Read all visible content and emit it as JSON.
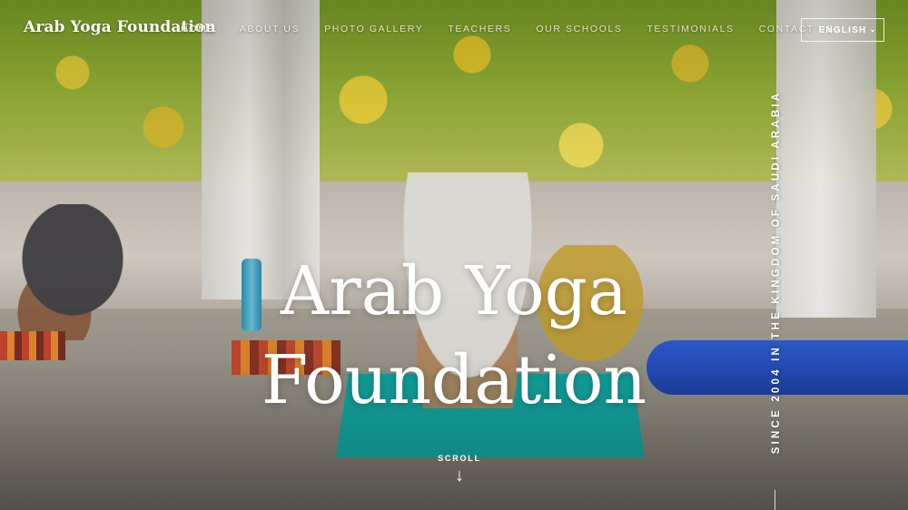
{
  "brand": {
    "name": "Arab Yoga Foundation"
  },
  "nav": {
    "items": [
      {
        "label": "HOME"
      },
      {
        "label": "ABOUT US"
      },
      {
        "label": "PHOTO GALLERY"
      },
      {
        "label": "TEACHERS"
      },
      {
        "label": "OUR SCHOOLS"
      },
      {
        "label": "TESTIMONIALS"
      },
      {
        "label": "CONTACT US"
      }
    ]
  },
  "language": {
    "selected": "ENGLISH"
  },
  "hero": {
    "title_line1": "Arab Yoga",
    "title_line2": "Foundation",
    "tagline": "SINCE 2004 IN THE KINGDOM OF SAUDI ARABIA",
    "scroll_label": "SCROLL"
  },
  "icons": {
    "scroll": "arrow-down-icon",
    "language": "chevron-down-icon"
  }
}
